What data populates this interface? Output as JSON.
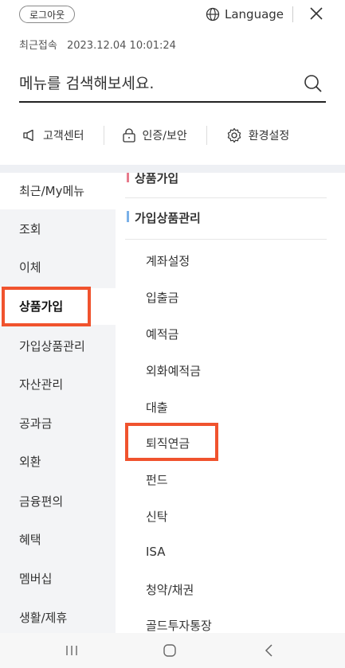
{
  "header": {
    "logout_label": "로그아웃",
    "language_label": "Language",
    "last_login_label": "최근접속",
    "last_login_value": "2023.12.04 10:01:24"
  },
  "search": {
    "placeholder": "메뉴를 검색해보세요."
  },
  "quick_links": [
    {
      "label": "고객센터",
      "icon": "megaphone-icon"
    },
    {
      "label": "인증/보안",
      "icon": "lock-icon"
    },
    {
      "label": "환경설정",
      "icon": "gear-icon"
    }
  ],
  "left_menu": [
    "최근/My메뉴",
    "조회",
    "이체",
    "상품가입",
    "가입상품관리",
    "자산관리",
    "공과금",
    "외환",
    "금융편의",
    "혜택",
    "멤버십",
    "생활/제휴"
  ],
  "left_menu_selected": "상품가입",
  "right_panel": {
    "section1_title": "상품가입",
    "section2_title": "가입상품관리",
    "items": [
      "계좌설정",
      "입출금",
      "예적금",
      "외화예적금",
      "대출",
      "퇴직연금",
      "펀드",
      "신탁",
      "ISA",
      "청약/채권",
      "골드투자통장"
    ]
  },
  "colors": {
    "highlight": "#f0532e",
    "section_red": "#e77b8c",
    "section_blue": "#7ab0e8"
  }
}
